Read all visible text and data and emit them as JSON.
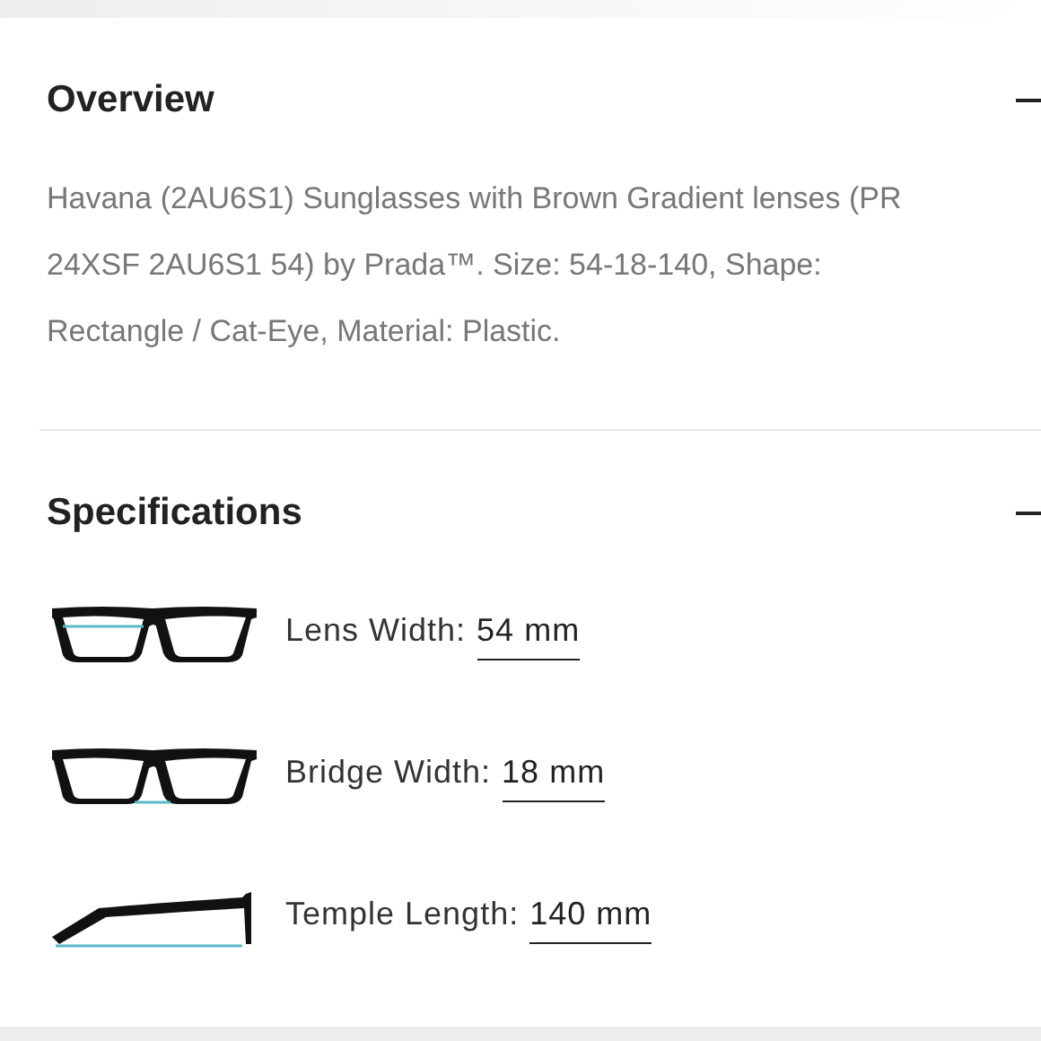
{
  "sections": [
    {
      "title": "Overview",
      "expanded": true,
      "kind": "text",
      "lines": [
        "Havana (2AU6S1) Sunglasses with Brown Gradient lenses (PR",
        "24XSF 2AU6S1 54) by Prada™. Size: 54-18-140, Shape:",
        "Rectangle / Cat-Eye, Material: Plastic."
      ]
    },
    {
      "title": "Specifications",
      "expanded": true,
      "kind": "specs",
      "rows": [
        {
          "kind": "lens",
          "label": "Lens Width:",
          "value": "54 mm"
        },
        {
          "kind": "bridge",
          "label": "Bridge Width:",
          "value": "18 mm"
        },
        {
          "kind": "temple",
          "label": "Temple Length:",
          "value": "140 mm"
        }
      ]
    }
  ]
}
